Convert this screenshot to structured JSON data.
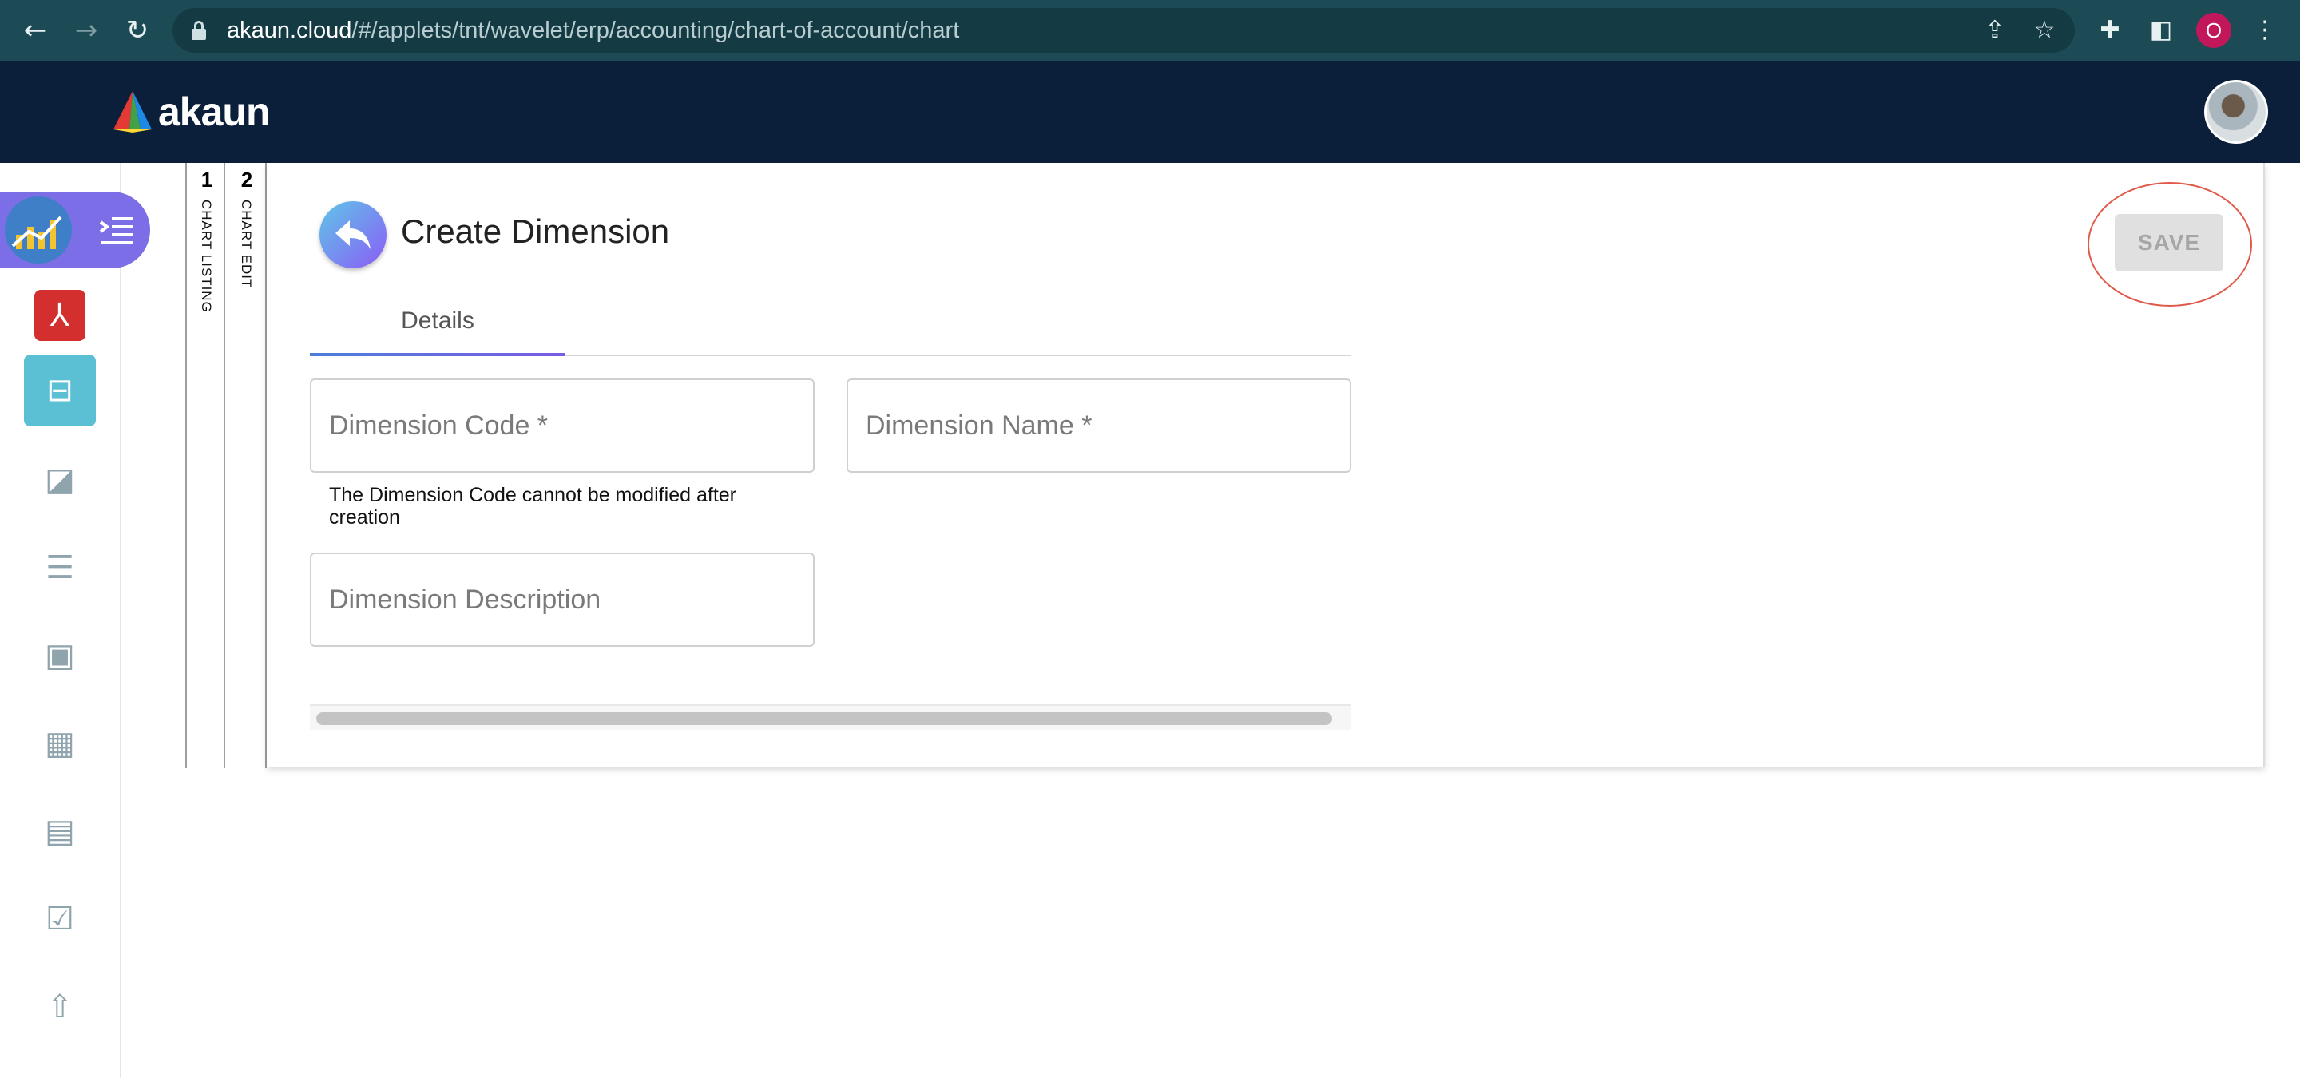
{
  "browser": {
    "url_host": "akaun.cloud",
    "url_path": "/#/applets/tnt/wavelet/erp/accounting/chart-of-account/chart",
    "profile_initial": "O",
    "icons": [
      "back-arrow",
      "forward-arrow",
      "reload",
      "lock",
      "share",
      "bookmark-star",
      "extensions",
      "side-panel",
      "profile",
      "kebab-menu"
    ]
  },
  "header": {
    "brand": "akaun",
    "brand_colors": [
      "#e53935",
      "#43a047",
      "#1e88e5",
      "#fdd835"
    ]
  },
  "sidebar": {
    "items": [
      {
        "icon": "chart-icon"
      },
      {
        "icon": "menu-toggle-icon"
      },
      {
        "icon": "acrobat-icon"
      },
      {
        "icon": "dashboard-icon",
        "active": true
      },
      {
        "icon": "tags-icon"
      },
      {
        "icon": "list-lines-icon"
      },
      {
        "icon": "terminal-icon"
      },
      {
        "icon": "building-icon"
      },
      {
        "icon": "library-icon"
      },
      {
        "icon": "calendar-check-icon"
      },
      {
        "icon": "upload-icon"
      }
    ]
  },
  "stepper": [
    {
      "number": "1",
      "label": "CHART LISTING"
    },
    {
      "number": "2",
      "label": "CHART EDIT"
    }
  ],
  "main": {
    "title": "Create Dimension",
    "tabs": [
      {
        "label": "Details",
        "active": true
      }
    ],
    "fields": {
      "code_placeholder": "Dimension Code *",
      "name_placeholder": "Dimension Name *",
      "description_placeholder": "Dimension Description"
    },
    "code_hint": "The Dimension Code cannot be modified after creation",
    "save_label": "SAVE",
    "accent": "#7a5be6",
    "highlight_color": "#e05a4a"
  }
}
